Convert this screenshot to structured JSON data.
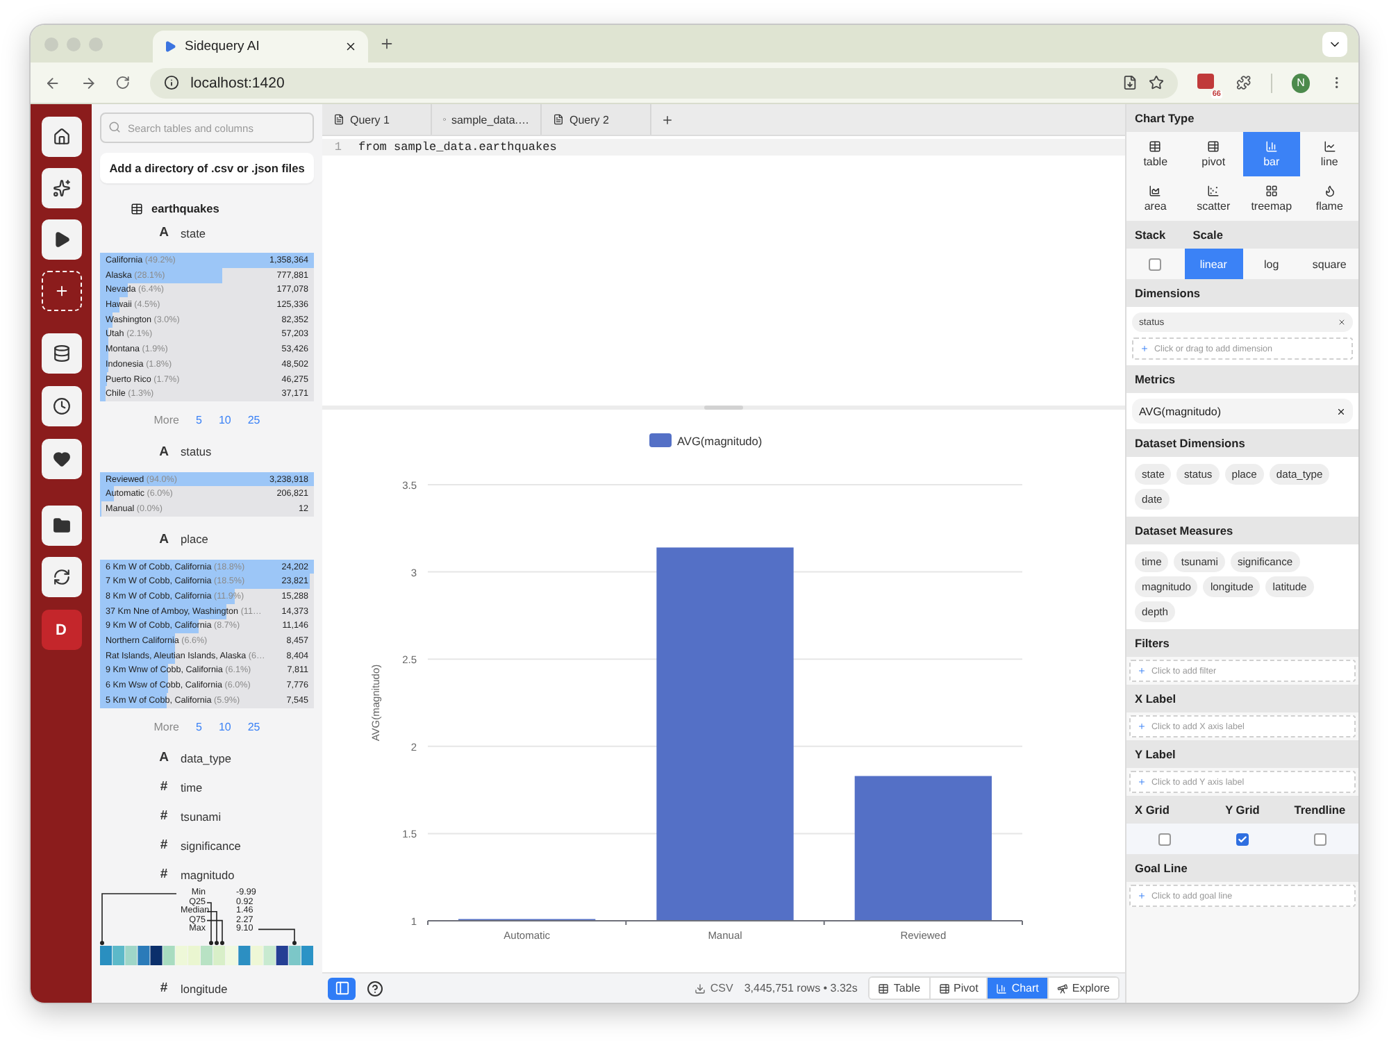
{
  "browser": {
    "tab_title": "Sidequery AI",
    "url": "localhost:1420",
    "extension_badge": "66",
    "profile_initial": "N"
  },
  "rail": {
    "badge": "D"
  },
  "explorer": {
    "search_placeholder": "Search tables and columns",
    "add_button": "Add a directory of .csv or .json files",
    "table": "earthquakes",
    "columns": [
      {
        "type_icon": "A",
        "name": "state",
        "values": [
          {
            "label": "California",
            "pct": "(49.2%)",
            "count": "1,358,364",
            "level": 1
          },
          {
            "label": "Alaska",
            "pct": "(28.1%)",
            "count": "777,881",
            "level": 0.57
          },
          {
            "label": "Nevada",
            "pct": "(6.4%)",
            "count": "177,078",
            "level": 0.13
          },
          {
            "label": "Hawaii",
            "pct": "(4.5%)",
            "count": "125,336",
            "level": 0.09
          },
          {
            "label": "Washington",
            "pct": "(3.0%)",
            "count": "82,352",
            "level": 0.06
          },
          {
            "label": "Utah",
            "pct": "(2.1%)",
            "count": "57,203",
            "level": 0.04
          },
          {
            "label": "Montana",
            "pct": "(1.9%)",
            "count": "53,426",
            "level": 0.04
          },
          {
            "label": "Indonesia",
            "pct": "(1.8%)",
            "count": "48,502",
            "level": 0.036
          },
          {
            "label": "Puerto Rico",
            "pct": "(1.7%)",
            "count": "46,275",
            "level": 0.034
          },
          {
            "label": "Chile",
            "pct": "(1.3%)",
            "count": "37,171",
            "level": 0.027
          }
        ],
        "more": {
          "label": "More",
          "options": [
            "5",
            "10",
            "25"
          ]
        }
      },
      {
        "type_icon": "A",
        "name": "status",
        "values": [
          {
            "label": "Reviewed",
            "pct": "(94.0%)",
            "count": "3,238,918",
            "level": 1
          },
          {
            "label": "Automatic",
            "pct": "(6.0%)",
            "count": "206,821",
            "level": 0.064
          },
          {
            "label": "Manual",
            "pct": "(0.0%)",
            "count": "12",
            "level": 0
          }
        ]
      },
      {
        "type_icon": "A",
        "name": "place",
        "values": [
          {
            "label": "6 Km W of Cobb, California",
            "pct": "(18.8%)",
            "count": "24,202",
            "level": 1
          },
          {
            "label": "7 Km W of Cobb, California",
            "pct": "(18.5%)",
            "count": "23,821",
            "level": 0.98
          },
          {
            "label": "8 Km W of Cobb, California",
            "pct": "(11.9%)",
            "count": "15,288",
            "level": 0.63
          },
          {
            "label": "37 Km Nne of Amboy, Washington",
            "pct": "(11…",
            "count": "14,373",
            "level": 0.59
          },
          {
            "label": "9 Km W of Cobb, California",
            "pct": "(8.7%)",
            "count": "11,146",
            "level": 0.46
          },
          {
            "label": "Northern California",
            "pct": "(6.6%)",
            "count": "8,457",
            "level": 0.35
          },
          {
            "label": "Rat Islands, Aleutian Islands, Alaska",
            "pct": "(6…",
            "count": "8,404",
            "level": 0.35
          },
          {
            "label": "9 Km Wnw of Cobb, California",
            "pct": "(6.1%)",
            "count": "7,811",
            "level": 0.32
          },
          {
            "label": "6 Km Wsw of Cobb, California",
            "pct": "(6.0%)",
            "count": "7,776",
            "level": 0.32
          },
          {
            "label": "5 Km W of Cobb, California",
            "pct": "(5.9%)",
            "count": "7,545",
            "level": 0.31
          }
        ],
        "more": {
          "label": "More",
          "options": [
            "5",
            "10",
            "25"
          ]
        }
      },
      {
        "type_icon": "A",
        "name": "data_type"
      },
      {
        "type_icon": "#",
        "name": "time"
      },
      {
        "type_icon": "#",
        "name": "tsunami"
      },
      {
        "type_icon": "#",
        "name": "significance"
      },
      {
        "type_icon": "#",
        "name": "magnitudo",
        "stats": [
          {
            "label": "Min",
            "value": "-9.99"
          },
          {
            "label": "Q25",
            "value": "0.92"
          },
          {
            "label": "Median",
            "value": "1.46"
          },
          {
            "label": "Q75",
            "value": "2.27"
          },
          {
            "label": "Max",
            "value": "9.10"
          }
        ]
      },
      {
        "type_icon": "#",
        "name": "longitude"
      }
    ]
  },
  "query_tabs": [
    {
      "title": "Query 1",
      "kind": "query"
    },
    {
      "title": "sample_data.…",
      "kind": "table"
    },
    {
      "title": "Query 2",
      "kind": "query"
    }
  ],
  "editor": {
    "lines": [
      {
        "number": "1",
        "code": "from sample_data.earthquakes"
      }
    ]
  },
  "chart": {
    "chart_data": {
      "type": "bar",
      "ylabel": "AVG(magnitudo)",
      "categories": [
        "Automatic",
        "Manual",
        "Reviewed"
      ],
      "series": [
        {
          "name": "AVG(magnitudo)",
          "color": "#5470c6",
          "values": [
            1.01,
            3.14,
            1.83
          ]
        }
      ],
      "ylim": [
        1,
        3.5
      ],
      "yticks": [
        1,
        1.5,
        2,
        2.5,
        3,
        3.5
      ],
      "grid": true
    }
  },
  "status_bar": {
    "export": "CSV",
    "summary": "3,445,751 rows • 3.32s",
    "views": [
      {
        "label": "Table",
        "selected": false
      },
      {
        "label": "Pivot",
        "selected": false
      },
      {
        "label": "Chart",
        "selected": true
      },
      {
        "label": "Explore",
        "selected": false
      }
    ]
  },
  "chart_settings": {
    "chart_type": {
      "title": "Chart Type",
      "options": [
        {
          "label": "table",
          "selected": false
        },
        {
          "label": "pivot",
          "selected": false
        },
        {
          "label": "bar",
          "selected": true
        },
        {
          "label": "line",
          "selected": false
        },
        {
          "label": "area",
          "selected": false
        },
        {
          "label": "scatter",
          "selected": false
        },
        {
          "label": "treemap",
          "selected": false
        },
        {
          "label": "flame",
          "selected": false
        }
      ]
    },
    "stack": {
      "title": "Stack",
      "checked": false
    },
    "scale": {
      "title": "Scale",
      "options": [
        {
          "label": "linear",
          "selected": true
        },
        {
          "label": "log",
          "selected": false
        },
        {
          "label": "square",
          "selected": false
        }
      ]
    },
    "dimensions": {
      "title": "Dimensions",
      "items": [
        "status"
      ],
      "prompt": "Click or drag to add dimension"
    },
    "metrics": {
      "title": "Metrics",
      "items": [
        "AVG(magnitudo)"
      ]
    },
    "dataset_dimensions": {
      "title": "Dataset Dimensions",
      "items": [
        "state",
        "status",
        "place",
        "data_type",
        "date"
      ]
    },
    "dataset_measures": {
      "title": "Dataset Measures",
      "items": [
        "time",
        "tsunami",
        "significance",
        "magnitudo",
        "longitude",
        "latitude",
        "depth"
      ]
    },
    "filters": {
      "title": "Filters",
      "prompt": "Click to add filter"
    },
    "x_label": {
      "title": "X Label",
      "prompt": "Click to add X axis label"
    },
    "y_label": {
      "title": "Y Label",
      "prompt": "Click to add Y axis label"
    },
    "toggles": [
      {
        "label": "X Grid",
        "checked": false
      },
      {
        "label": "Y Grid",
        "checked": true
      },
      {
        "label": "Trendline",
        "checked": false
      }
    ],
    "goal_line": {
      "title": "Goal Line",
      "prompt": "Click to add goal line"
    }
  }
}
